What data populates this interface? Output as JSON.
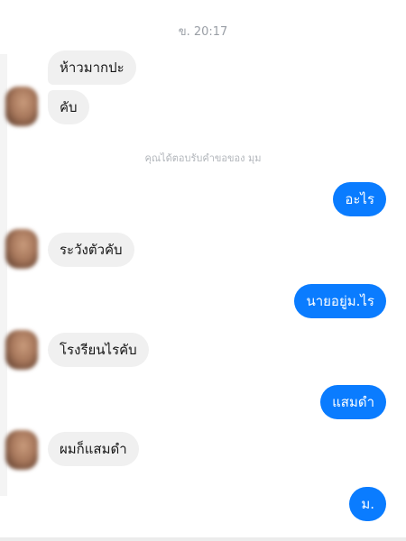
{
  "chat": {
    "timestamp": "ข. 20:17",
    "notice": "คุณได้ตอบรับคำขอของ มุม",
    "messages": [
      {
        "from": "them",
        "text": "ห้าวมากปะ"
      },
      {
        "from": "them",
        "text": "คับ"
      },
      {
        "from": "me",
        "text": "อะไร"
      },
      {
        "from": "them",
        "text": "ระวังตัวคับ"
      },
      {
        "from": "me",
        "text": "นายอยู่ม.ไร"
      },
      {
        "from": "them",
        "text": "โรงรียนไรคับ"
      },
      {
        "from": "me",
        "text": "แสมดำ"
      },
      {
        "from": "them",
        "text": "ผมก็แสมดำ"
      },
      {
        "from": "me",
        "text": "ม."
      }
    ]
  },
  "colors": {
    "outgoing_bubble": "#0a7cff",
    "incoming_bubble": "#f0f0f0",
    "meta_text": "#9a9fa6"
  }
}
